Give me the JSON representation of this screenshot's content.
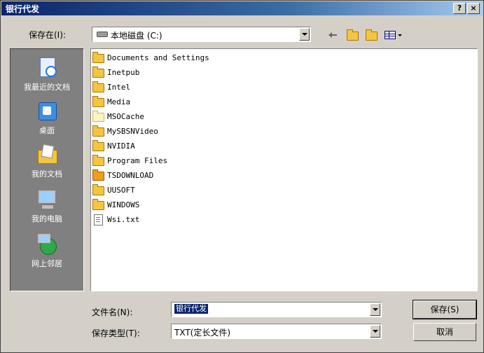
{
  "window": {
    "title": "银行代发",
    "help": "?",
    "close": "×"
  },
  "location": {
    "label": "保存在(I):",
    "value": "本地磁盘 (C:)"
  },
  "places": [
    {
      "label": "我最近的文档"
    },
    {
      "label": "桌面"
    },
    {
      "label": "我的文档"
    },
    {
      "label": "我的电脑"
    },
    {
      "label": "网上邻居"
    }
  ],
  "files": [
    {
      "name": "Documents and Settings",
      "type": "folder"
    },
    {
      "name": "Inetpub",
      "type": "folder"
    },
    {
      "name": "Intel",
      "type": "folder"
    },
    {
      "name": "Media",
      "type": "folder"
    },
    {
      "name": "MSOCache",
      "type": "folder-hidden"
    },
    {
      "name": "MySBSNVideo",
      "type": "folder"
    },
    {
      "name": "NVIDIA",
      "type": "folder"
    },
    {
      "name": "Program Files",
      "type": "folder"
    },
    {
      "name": "TSDOWNLOAD",
      "type": "folder-special"
    },
    {
      "name": "UUSOFT",
      "type": "folder"
    },
    {
      "name": "WINDOWS",
      "type": "folder"
    },
    {
      "name": "Wsi.txt",
      "type": "text"
    }
  ],
  "filename": {
    "label": "文件名(N):",
    "value": "银行代发"
  },
  "filetype": {
    "label": "保存类型(T):",
    "value": "TXT(定长文件)"
  },
  "buttons": {
    "save": "保存(S)",
    "cancel": "取消"
  }
}
